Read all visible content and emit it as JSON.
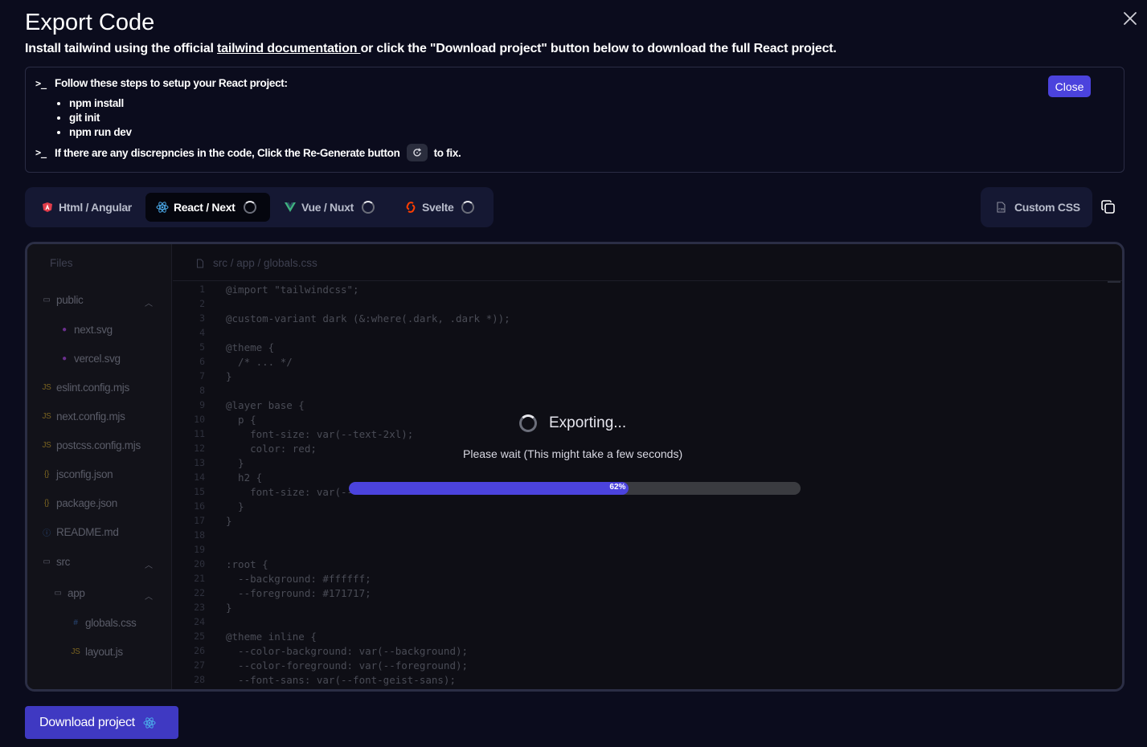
{
  "header": {
    "title": "Export Code",
    "subtitle_prefix": "Install tailwind using the official ",
    "subtitle_link": "tailwind documentation ",
    "subtitle_suffix": "or click the \"Download project\" button below to download the full React project."
  },
  "steps": {
    "prompt_symbol": ">_",
    "intro": "Follow these steps to setup your React project:",
    "items": [
      "npm install",
      "git init",
      "npm run dev"
    ],
    "regen_prefix": "If there are any discrepncies in the code, Click the Re-Generate button",
    "regen_suffix": "to fix.",
    "close_label": "Close"
  },
  "tabs": [
    {
      "label": "Html / Angular",
      "icon": "angular-icon",
      "color": "#e23d4b",
      "active": false,
      "loading": false
    },
    {
      "label": "React / Next",
      "icon": "react-icon",
      "color": "#4aa8e8",
      "active": true,
      "loading": true
    },
    {
      "label": "Vue / Nuxt",
      "icon": "vue-icon",
      "color": "#3fb27f",
      "active": false,
      "loading": true
    },
    {
      "label": "Svelte",
      "icon": "svelte-icon",
      "color": "#ff3e00",
      "active": false,
      "loading": true
    }
  ],
  "custom_css": {
    "label": "Custom CSS",
    "icon": "css-file-icon"
  },
  "files": {
    "header": "Files",
    "items": [
      {
        "name": "public",
        "type": "folder",
        "expanded": true
      },
      {
        "name": "next.svg",
        "type": "svg"
      },
      {
        "name": "vercel.svg",
        "type": "svg"
      },
      {
        "name": "eslint.config.mjs",
        "type": "js"
      },
      {
        "name": "next.config.mjs",
        "type": "js"
      },
      {
        "name": "postcss.config.mjs",
        "type": "js"
      },
      {
        "name": "jsconfig.json",
        "type": "json"
      },
      {
        "name": "package.json",
        "type": "json"
      },
      {
        "name": "README.md",
        "type": "md"
      },
      {
        "name": "src",
        "type": "folder",
        "expanded": true
      },
      {
        "name": "app",
        "type": "folder",
        "expanded": true
      },
      {
        "name": "globals.css",
        "type": "css"
      },
      {
        "name": "layout.js",
        "type": "js"
      }
    ]
  },
  "editor": {
    "path": "src / app / globals.css",
    "lines": [
      "@import \"tailwindcss\";",
      "",
      "@custom-variant dark (&:where(.dark, .dark *));",
      "",
      "@theme {",
      "  /* ... */",
      "}",
      "",
      "@layer base {",
      "  p {",
      "    font-size: var(--text-2xl);",
      "    color: red;",
      "  }",
      "  h2 {",
      "    font-size: var(--",
      "  }",
      "}",
      "",
      "",
      ":root {",
      "  --background: #ffffff;",
      "  --foreground: #171717;",
      "}",
      "",
      "@theme inline {",
      "  --color-background: var(--background);",
      "  --color-foreground: var(--foreground);",
      "  --font-sans: var(--font-geist-sans);"
    ]
  },
  "export_status": {
    "title": "Exporting...",
    "message": "Please wait (This might take a few seconds)",
    "progress_percent": 62,
    "progress_label": "62%"
  },
  "footer": {
    "download_label": "Download project"
  },
  "colors": {
    "accent": "#4b43dd",
    "background": "#0b0c1d"
  }
}
